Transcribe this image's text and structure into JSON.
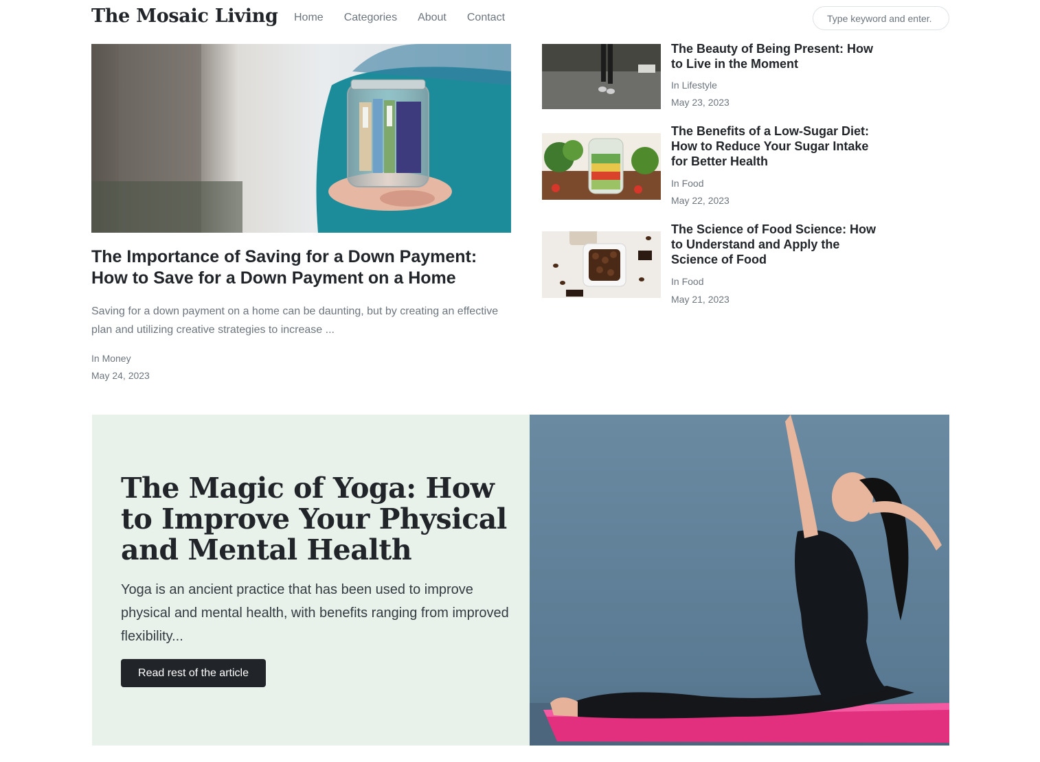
{
  "nav": {
    "brand": "The Mosaic Living",
    "links": [
      "Home",
      "Categories",
      "About",
      "Contact"
    ],
    "search_placeholder": "Type keyword and enter."
  },
  "featured": {
    "title": "The Importance of Saving for a Down Payment: How to Save for a Down Payment on a Home",
    "excerpt": "Saving for a down payment on a home can be daunting, but by creating an effective plan and utilizing creative strategies to increase ...",
    "category": "In Money",
    "date": "May 24, 2023",
    "image": "jar-of-money-photo"
  },
  "side_posts": [
    {
      "title": "The Beauty of Being Present: How to Live in the Moment",
      "category": "In Lifestyle",
      "date": "May 23, 2023",
      "image": "walking-legs-photo"
    },
    {
      "title": "The Benefits of a Low-Sugar Diet: How to Reduce Your Sugar Intake for Better Health",
      "category": "In Food",
      "date": "May 22, 2023",
      "image": "salad-jar-photo"
    },
    {
      "title": "The Science of Food Science: How to Understand and Apply the Science of Food",
      "category": "In Food",
      "date": "May 21, 2023",
      "image": "coffee-beans-photo"
    }
  ],
  "hero": {
    "title": "The Magic of Yoga: How to Improve Your Physical and Mental Health",
    "excerpt": "Yoga is an ancient practice that has been used to improve physical and mental health, with benefits ranging from improved flexibility...",
    "button_label": "Read rest of the article",
    "image": "yoga-pose-photo"
  },
  "colors": {
    "hero_bg": "#e8f2ea",
    "button_bg": "#212529",
    "muted_text": "#6c757d",
    "yoga_bg": "#5f7f98",
    "yoga_mat": "#e2307e"
  }
}
